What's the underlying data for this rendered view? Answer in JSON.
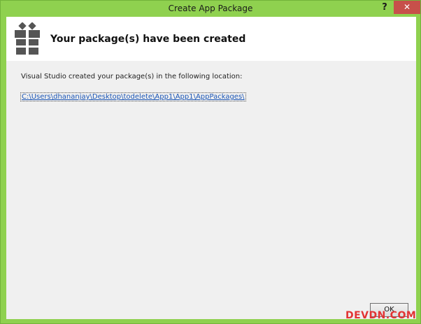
{
  "window": {
    "title": "Create App Package",
    "help_label": "?",
    "close_label": "✕"
  },
  "header": {
    "title": "Your package(s) have been created",
    "icon": "gift-icon"
  },
  "content": {
    "message": "Visual Studio created your package(s) in the following location:",
    "location_link": "C:\\Users\\dhananjay\\Desktop\\todelete\\App1\\App1\\AppPackages\\"
  },
  "footer": {
    "ok_label": "OK"
  },
  "watermark": {
    "text": "DEVDN.COM"
  },
  "colors": {
    "window_frame": "#8fd14f",
    "close_button": "#c7504a",
    "link": "#1a55b5",
    "watermark": "#e23333"
  }
}
